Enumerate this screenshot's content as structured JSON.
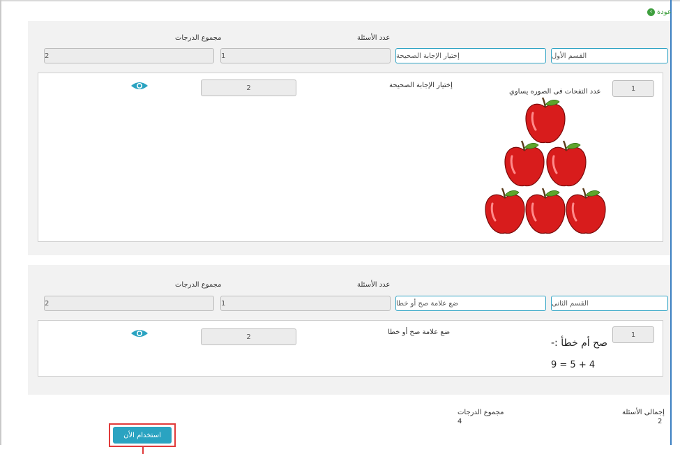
{
  "nav": {
    "back_label": "عودة"
  },
  "labels": {
    "questions_count": "عدد الأسئلة",
    "total_grades": "مجموع الدرجات"
  },
  "section1": {
    "name": "القسم الأول",
    "type": "إختيار الإجابة الصحيحة",
    "question_count": "1",
    "total_grades": "2",
    "question": {
      "number": "1",
      "text": "عدد التفحات فى الصوره يساوي",
      "type_label": "إختيار الإجابة الصحيحة",
      "grade": "2"
    }
  },
  "section2": {
    "name": "القسم الثانى",
    "type": "ضع علامة صح أو خطا",
    "question_count": "1",
    "total_grades": "2",
    "question": {
      "number": "1",
      "title": "صح أم خطأ :-",
      "equation": "9 = 5 + 4",
      "type_label": "ضع علامة صح أو خطا",
      "grade": "2"
    }
  },
  "summary": {
    "total_questions_label": "إجمالى الأسئلة",
    "total_questions_value": "2",
    "total_grades_label": "مجموع الدرجات",
    "total_grades_value": "4",
    "use_now_label": "استخدام الأن"
  },
  "colors": {
    "accent": "#2aa3c1",
    "highlight": "#e03a3a",
    "back_green": "#3f9f3f",
    "apple_red": "#d81c1c"
  },
  "icons": [
    "back-circle-icon",
    "eye-icon",
    "apple-icon"
  ]
}
